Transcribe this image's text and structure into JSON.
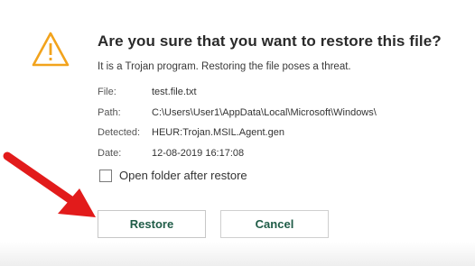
{
  "dialog": {
    "title": "Are you sure that you want to restore this file?",
    "subtitle": "It is a Trojan program. Restoring the file poses a threat.",
    "icon": "warning-triangle-icon",
    "details": {
      "file_label": "File:",
      "file_value": "test.file.txt",
      "path_label": "Path:",
      "path_value": "C:\\Users\\User1\\AppData\\Local\\Microsoft\\Windows\\",
      "detected_label": "Detected:",
      "detected_value": "HEUR:Trojan.MSIL.Agent.gen",
      "date_label": "Date:",
      "date_value": "12-08-2019 16:17:08"
    },
    "open_folder_checkbox": {
      "label": "Open folder after restore",
      "checked": false
    },
    "buttons": {
      "restore_label": "Restore",
      "cancel_label": "Cancel"
    }
  },
  "colors": {
    "warning": "#f2a31c",
    "button_text": "#1f5c47",
    "annotation_arrow": "#e21b1b"
  }
}
